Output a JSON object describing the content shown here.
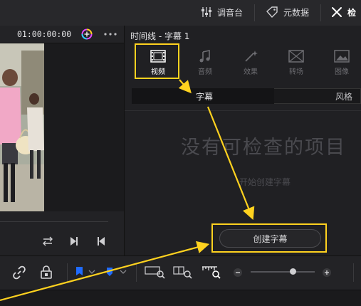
{
  "topbar": {
    "mixer_label": "调音台",
    "metadata_label": "元数据",
    "inspector_label": "检"
  },
  "viewer": {
    "timecode": "01:00:00:00"
  },
  "inspector": {
    "title": "时间线 - 字幕 1",
    "tabs": [
      {
        "label": "视频",
        "icon": "film-icon",
        "active": true
      },
      {
        "label": "音频",
        "icon": "music-note-icon",
        "active": false
      },
      {
        "label": "效果",
        "icon": "magic-wand-icon",
        "active": false
      },
      {
        "label": "转场",
        "icon": "transition-icon",
        "active": false
      },
      {
        "label": "图像",
        "icon": "image-icon",
        "active": false
      }
    ],
    "subtabs": {
      "subtitle": "字幕",
      "style": "风格"
    },
    "empty_title": "没有可检查的项目",
    "empty_hint": "开始创建字幕",
    "create_button": "创建字幕"
  },
  "colors": {
    "highlight": "#ffd21f",
    "accent_blue": "#1f6bff",
    "background": "#1e1e21"
  }
}
